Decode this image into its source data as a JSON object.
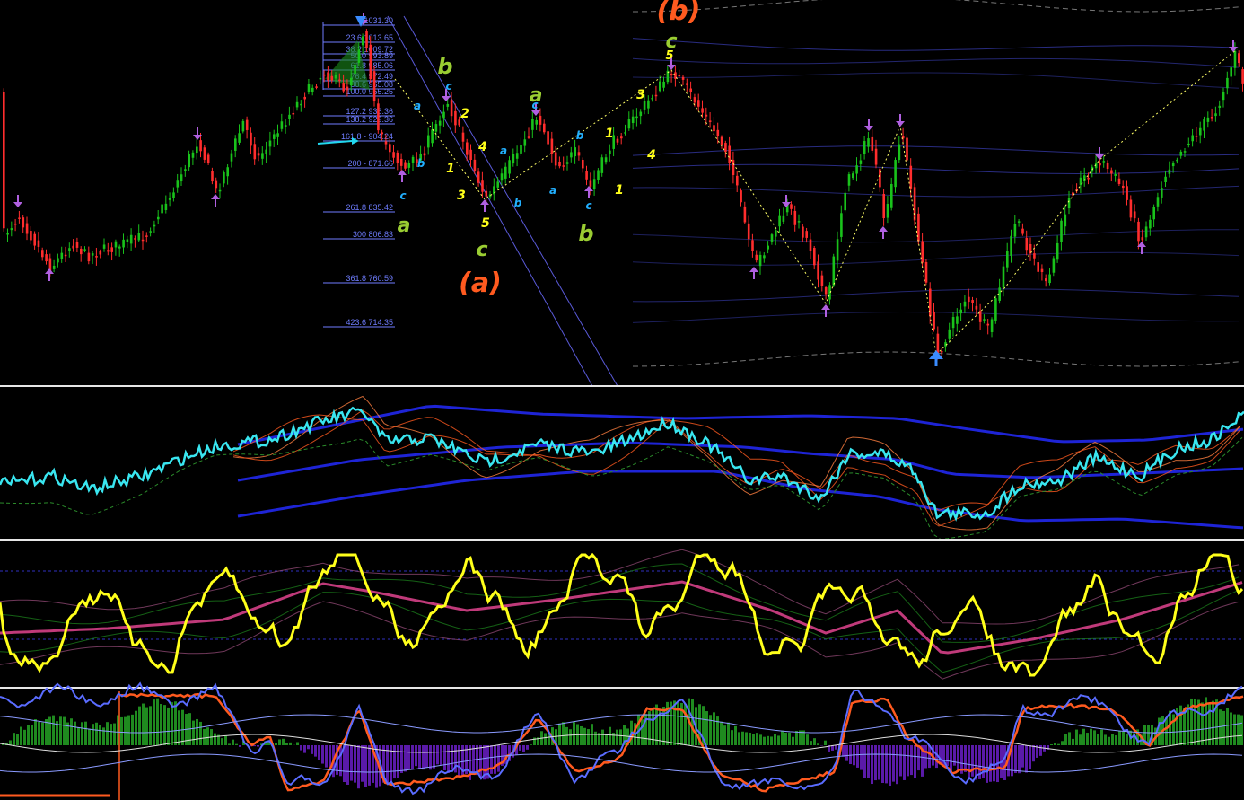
{
  "colors": {
    "background": "#000000",
    "bull_candle": "#19c21b",
    "bear_candle": "#ff2d2d",
    "fib": "#6f7dff",
    "channel": "#3a3fb8",
    "envelope": "#1e24d6",
    "line_cyan": "#39e6f0",
    "line_yellow": "#ffff1a",
    "line_magenta": "#c03a7a",
    "line_orange": "#ff5a1f",
    "line_blue": "#5a6cff",
    "hist_green": "#1f8a1f",
    "hist_purple": "#5a1aa8",
    "arrow_down": "#b060e0",
    "arrow_up_blue": "#3a8cff",
    "label_green": "#9acd32",
    "label_yellow": "#ffff1a",
    "label_cyan": "#22b0ff",
    "label_orange": "#ff5a1f",
    "separator": "#e6e6e6"
  },
  "chart_data": [
    {
      "type": "candlestick",
      "panel": "price",
      "title": "",
      "fib_levels": [
        "1031.30",
        "23.6 1013.65",
        "38.2 1009.72",
        "50.0 993.89",
        "61.8 985.06",
        "76.4 972.49",
        "88.6 965.08",
        "100.0 955.25",
        "127.2 936.36",
        "138.2 929.36",
        "161.8 - 904.24",
        "200 - 871.66",
        "261.8 835.42",
        "300 806.83",
        "361.8 760.59",
        "423.6 714.35"
      ],
      "wave_labels": [
        {
          "text": "(b)",
          "color": "label_orange"
        },
        {
          "text": "(a)",
          "color": "label_orange"
        },
        {
          "text": "b",
          "color": "label_green"
        },
        {
          "text": "a",
          "color": "label_green"
        },
        {
          "text": "c",
          "color": "label_green"
        },
        {
          "text": "a",
          "color": "label_green"
        },
        {
          "text": "b",
          "color": "label_green"
        },
        {
          "text": "c",
          "color": "label_green"
        },
        {
          "text": "1",
          "color": "label_yellow"
        },
        {
          "text": "2",
          "color": "label_yellow"
        },
        {
          "text": "3",
          "color": "label_yellow"
        },
        {
          "text": "4",
          "color": "label_yellow"
        },
        {
          "text": "5",
          "color": "label_yellow"
        },
        {
          "text": "1",
          "color": "label_yellow"
        },
        {
          "text": "1",
          "color": "label_yellow"
        },
        {
          "text": "3",
          "color": "label_yellow"
        },
        {
          "text": "4",
          "color": "label_yellow"
        },
        {
          "text": "5",
          "color": "label_yellow"
        },
        {
          "text": "a",
          "color": "label_cyan"
        },
        {
          "text": "b",
          "color": "label_cyan"
        },
        {
          "text": "c",
          "color": "label_cyan"
        },
        {
          "text": "c",
          "color": "label_cyan"
        },
        {
          "text": "a",
          "color": "label_cyan"
        },
        {
          "text": "b",
          "color": "label_cyan"
        },
        {
          "text": "a",
          "color": "label_cyan"
        },
        {
          "text": "b",
          "color": "label_cyan"
        },
        {
          "text": "c",
          "color": "label_cyan"
        },
        {
          "text": "c",
          "color": "label_cyan"
        }
      ]
    },
    {
      "type": "line",
      "panel": "indicator-1",
      "series": [
        {
          "color": "line_cyan"
        },
        {
          "color": "envelope"
        },
        {
          "color": "line_orange"
        }
      ]
    },
    {
      "type": "line",
      "panel": "indicator-2",
      "series": [
        {
          "color": "line_yellow"
        },
        {
          "color": "line_magenta"
        }
      ]
    },
    {
      "type": "bar",
      "panel": "indicator-3",
      "series": [
        {
          "color": "hist_green"
        },
        {
          "color": "line_orange"
        },
        {
          "color": "line_blue"
        }
      ]
    }
  ]
}
